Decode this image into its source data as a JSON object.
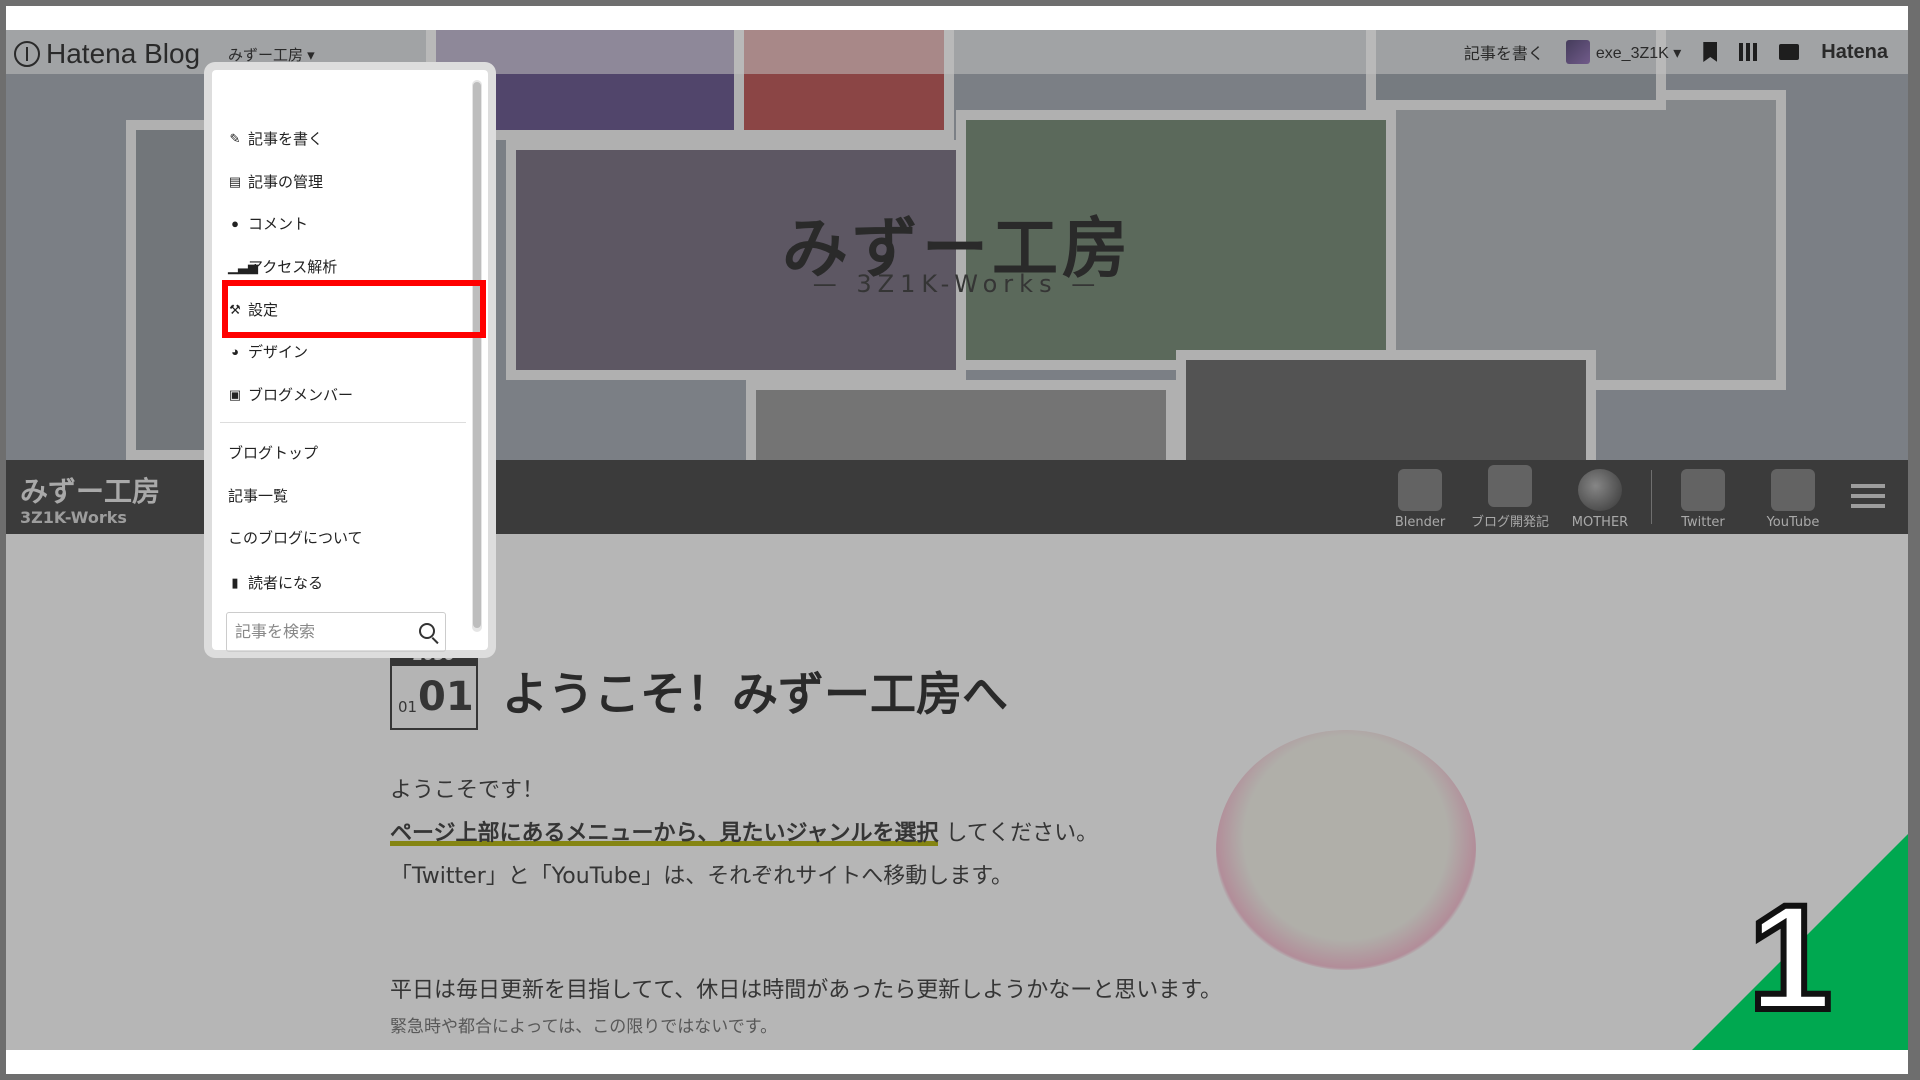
{
  "toolbar": {
    "logo": "Hatena Blog",
    "blog_menu": "みずー工房 ▾",
    "write_label": "記事を書く",
    "user": "exe_3Z1K ▾",
    "hatena": "Hatena"
  },
  "header": {
    "title": "みずー工房",
    "subtitle": "— 3Z1K-Works —"
  },
  "navbar": {
    "title": "みずー工房",
    "subtitle": "3Z1K-Works",
    "items": [
      {
        "label": "Blender"
      },
      {
        "label": "ブログ開発記"
      },
      {
        "label": "MOTHER"
      },
      {
        "label": "Twitter"
      },
      {
        "label": "YouTube"
      }
    ]
  },
  "dropdown": {
    "items": [
      {
        "label": "記事を書く",
        "icon": "edit-icon"
      },
      {
        "label": "記事の管理",
        "icon": "document-icon"
      },
      {
        "label": "コメント",
        "icon": "comment-icon"
      },
      {
        "label": "アクセス解析",
        "icon": "signal-icon"
      },
      {
        "label": "設定",
        "icon": "wrench-icon"
      },
      {
        "label": "デザイン",
        "icon": "palette-icon"
      },
      {
        "label": "ブログメンバー",
        "icon": "members-icon"
      }
    ],
    "links": [
      {
        "label": "ブログトップ"
      },
      {
        "label": "記事一覧"
      },
      {
        "label": "このブログについて"
      },
      {
        "label": "読者になる"
      }
    ],
    "search_placeholder": "記事を検索"
  },
  "entry": {
    "year": "2050",
    "month": "01",
    "day": "01",
    "title": "ようこそ！みずー工房へ",
    "line1": "ようこそです！",
    "line2_highlight": "ページ上部にあるメニューから、見たいジャンルを選択",
    "line2_rest": "してください。",
    "line3": "「Twitter」と「YouTube」は、それぞれサイトへ移動します。",
    "line4": "平日は毎日更新を目指してて、休日は時間があったら更新しようかなーと思います。",
    "line5": "緊急時や都合によっては、この限りではないです。"
  },
  "step": {
    "number": "1"
  },
  "colors": {
    "highlight": "#ff0000",
    "step_bg": "#00a850"
  }
}
